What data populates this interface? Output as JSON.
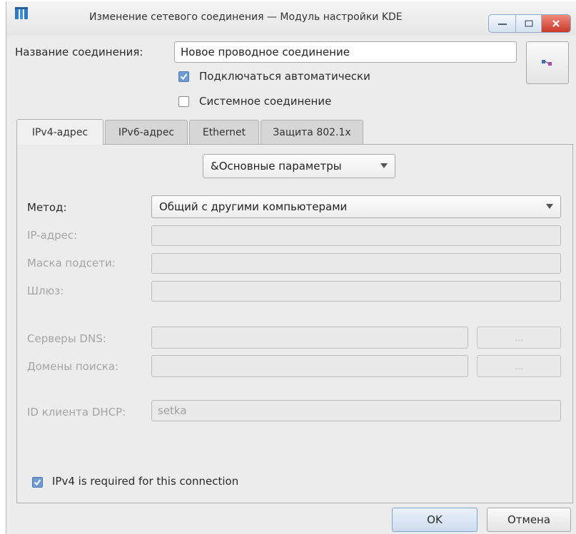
{
  "window": {
    "title": "Изменение сетевого соединения — Модуль настройки KDE"
  },
  "connection": {
    "name_label": "Название соединения:",
    "name_label_accel": "с",
    "name_value": "Новое проводное соединение",
    "auto_connect_label": "Подключаться автоматически",
    "auto_connect_checked": true,
    "system_label": "Системное соединение",
    "system_checked": false
  },
  "tabs": [
    {
      "label": "IPv4-адрес",
      "active": true
    },
    {
      "label": "IPv6-адрес",
      "active": false
    },
    {
      "label": "Ethernet",
      "active": false
    },
    {
      "label": "Защита 802.1x",
      "active": false
    }
  ],
  "ipv4": {
    "mode_combo": "&Основные параметры",
    "method_label": "Метод:",
    "method_value": "Общий с другими компьютерами",
    "ip_label": "IP-адрес:",
    "mask_label": "Маска подсети:",
    "gateway_label": "Шлюз:",
    "dns_label": "Серверы DNS:",
    "search_label": "Домены поиска:",
    "dns_button": "...",
    "search_button": "...",
    "dhcp_label": "ID клиента DHCP:",
    "dhcp_value": "setka",
    "required_label": "IPv4 is required for this connection",
    "required_checked": true
  },
  "footer": {
    "ok_label": "OK",
    "cancel_label": "Отмена"
  },
  "colors": {
    "accent": "#6f9bd1",
    "close_button": "#c9382a"
  }
}
